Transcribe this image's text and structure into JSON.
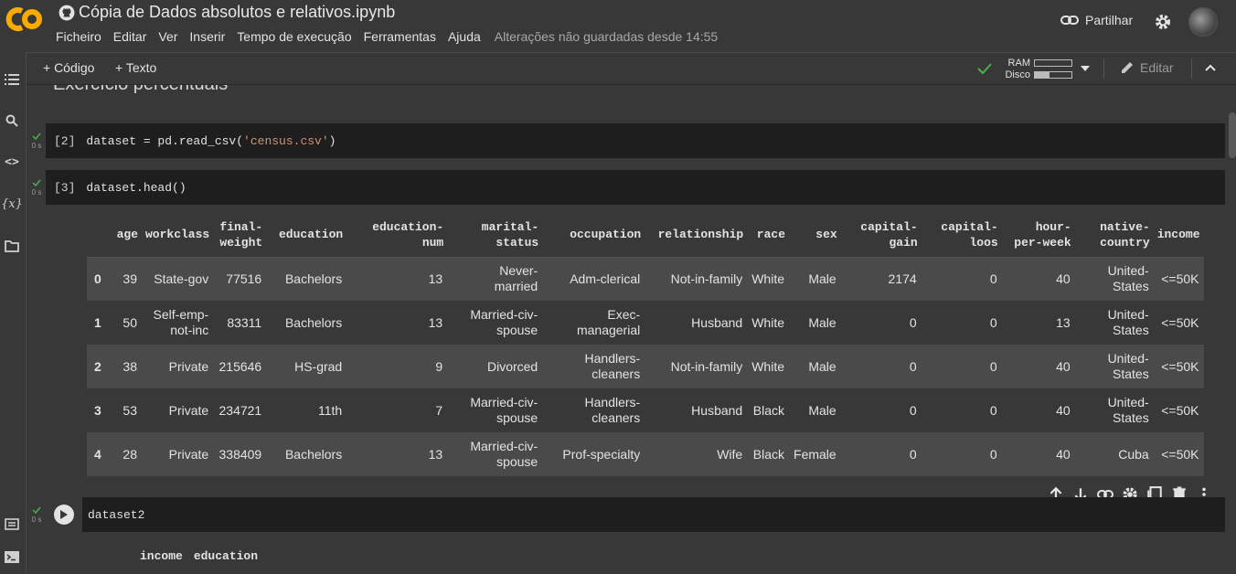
{
  "app": {
    "title": "Cópia de Dados absolutos e relativos.ipynb",
    "menu": [
      "Ficheiro",
      "Editar",
      "Ver",
      "Inserir",
      "Tempo de execução",
      "Ferramentas",
      "Ajuda"
    ],
    "unsaved": "Alterações não guardadas desde 14:55",
    "share_label": "Partilhar"
  },
  "toolbar": {
    "add_code": "+ Código",
    "add_text": "+ Texto",
    "ram_label": "RAM",
    "disk_label": "Disco",
    "ram_usage": 0.0,
    "disk_usage": 0.4,
    "edit_label": "Editar"
  },
  "notebook": {
    "heading_partial": "Exercício percentuais",
    "cells": [
      {
        "prompt": "[2]",
        "code_pre": "dataset = pd.read_csv(",
        "code_str": "'census.csv'",
        "code_post": ")",
        "time": "0 s"
      },
      {
        "prompt": "[3]",
        "code": "dataset.head()",
        "time": "0 s"
      },
      {
        "code": "dataset2",
        "time": "0 s"
      }
    ],
    "table": {
      "columns": [
        [
          "",
          ""
        ],
        [
          "",
          "age"
        ],
        [
          "",
          "workclass"
        ],
        [
          "final-",
          "weight"
        ],
        [
          "",
          "education"
        ],
        [
          "education-",
          "num"
        ],
        [
          "marital-",
          "status"
        ],
        [
          "",
          "occupation"
        ],
        [
          "",
          "relationship"
        ],
        [
          "",
          "race"
        ],
        [
          "",
          "sex"
        ],
        [
          "capital-",
          "gain"
        ],
        [
          "capital-",
          "loos"
        ],
        [
          "hour-",
          "per-week"
        ],
        [
          "native-",
          "country"
        ],
        [
          "",
          "income"
        ]
      ],
      "rows": [
        [
          "0",
          "39",
          [
            "State-gov"
          ],
          "77516",
          "Bachelors",
          "13",
          [
            "Never-",
            "married"
          ],
          [
            "Adm-clerical"
          ],
          "Not-in-family",
          "White",
          "Male",
          "2174",
          "0",
          "40",
          [
            "United-",
            "States"
          ],
          "<=50K"
        ],
        [
          "1",
          "50",
          [
            "Self-emp-",
            "not-inc"
          ],
          "83311",
          "Bachelors",
          "13",
          [
            "Married-civ-",
            "spouse"
          ],
          [
            "Exec-",
            "managerial"
          ],
          "Husband",
          "White",
          "Male",
          "0",
          "0",
          "13",
          [
            "United-",
            "States"
          ],
          "<=50K"
        ],
        [
          "2",
          "38",
          [
            "Private"
          ],
          "215646",
          "HS-grad",
          "9",
          [
            "Divorced"
          ],
          [
            "Handlers-",
            "cleaners"
          ],
          "Not-in-family",
          "White",
          "Male",
          "0",
          "0",
          "40",
          [
            "United-",
            "States"
          ],
          "<=50K"
        ],
        [
          "3",
          "53",
          [
            "Private"
          ],
          "234721",
          "11th",
          "7",
          [
            "Married-civ-",
            "spouse"
          ],
          [
            "Handlers-",
            "cleaners"
          ],
          "Husband",
          "Black",
          "Male",
          "0",
          "0",
          "40",
          [
            "United-",
            "States"
          ],
          "<=50K"
        ],
        [
          "4",
          "28",
          [
            "Private"
          ],
          "338409",
          "Bachelors",
          "13",
          [
            "Married-civ-",
            "spouse"
          ],
          [
            "Prof-specialty"
          ],
          "Wife",
          "Black",
          "Female",
          "0",
          "0",
          "40",
          [
            "Cuba"
          ],
          "<=50K"
        ]
      ]
    },
    "table2_columns": [
      "income",
      "education"
    ]
  },
  "colors": {
    "logo": "#f9ab00",
    "check": "#4caf50",
    "bg": "#383838",
    "cell": "#1e1e1e"
  }
}
